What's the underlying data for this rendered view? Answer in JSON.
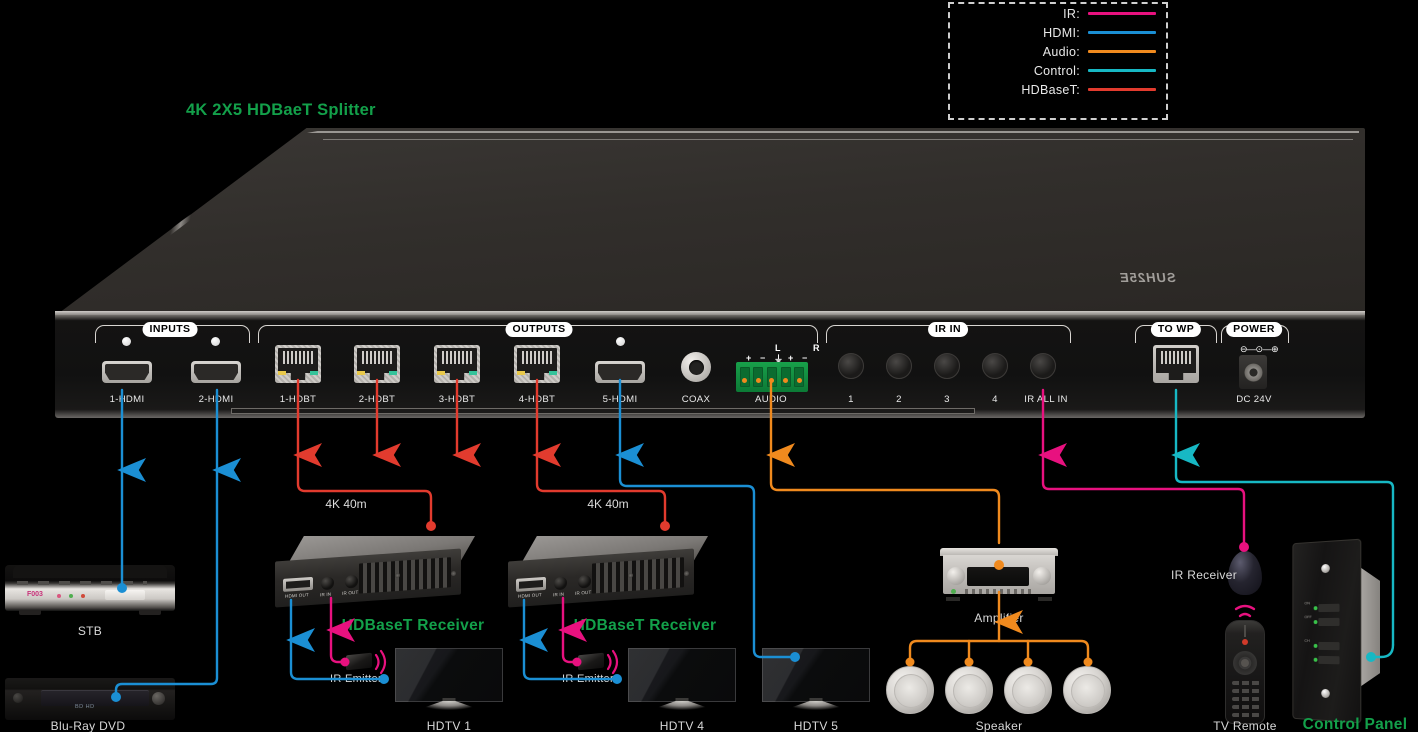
{
  "title": "4K 2X5 HDBaeT Splitter",
  "brand": "SUH25E",
  "legend": {
    "items": [
      {
        "label": "IR:",
        "color": "#e8117f"
      },
      {
        "label": "HDMI:",
        "color": "#1b8fd4"
      },
      {
        "label": "Audio:",
        "color": "#f08a1e"
      },
      {
        "label": "Control:",
        "color": "#17b8c4"
      },
      {
        "label": "HDBaseT:",
        "color": "#e23b2e"
      }
    ]
  },
  "panel": {
    "groups": [
      {
        "name": "INPUTS"
      },
      {
        "name": "OUTPUTS"
      },
      {
        "name": "IR IN"
      },
      {
        "name": "TO WP"
      },
      {
        "name": "POWER"
      }
    ],
    "inputs": [
      "1-HDMI",
      "2-HDMI"
    ],
    "outputs": [
      "1-HDBT",
      "2-HDBT",
      "3-HDBT",
      "4-HDBT",
      "5-HDMI",
      "COAX",
      "AUDIO"
    ],
    "audio_marks": {
      "left": "L",
      "right": "R",
      "pins": [
        "+",
        "−",
        "⏚",
        "+",
        "−"
      ]
    },
    "ir_in": [
      "1",
      "2",
      "3",
      "4",
      "IR ALL IN"
    ],
    "power": "DC 24V"
  },
  "devices": {
    "stb": "STB",
    "bluray": "Blu-Ray DVD",
    "receiver_1": "HDBaseT Receiver",
    "receiver_2": "HDBaseT Receiver",
    "emitter_1": "IR Emitter",
    "emitter_2": "IR Emitter",
    "hdtv_1": "HDTV 1",
    "hdtv_4": "HDTV 4",
    "hdtv_5": "HDTV 5",
    "amplifier": "Amplifier",
    "speaker": "Speaker",
    "ir_receiver": "IR Receiver",
    "tv_remote": "TV Remote",
    "control_panel": "Control Panel"
  },
  "cables": {
    "run_1": "4K 40m",
    "run_2": "4K 40m"
  }
}
